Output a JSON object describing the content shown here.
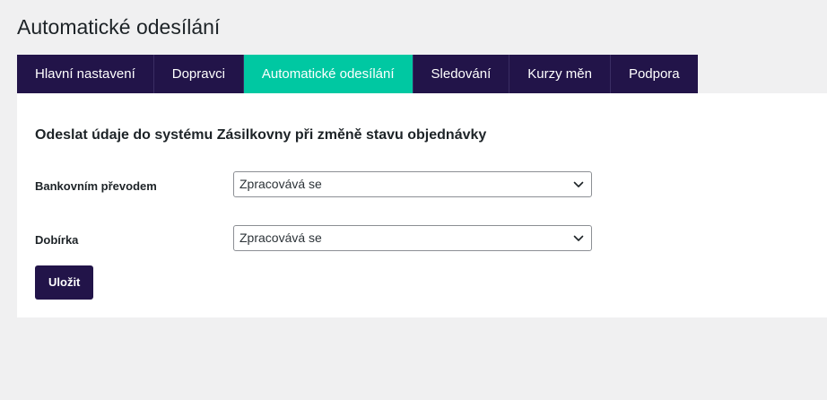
{
  "page": {
    "title": "Automatické odesílání"
  },
  "tabs": [
    {
      "label": "Hlavní nastavení",
      "active": false
    },
    {
      "label": "Dopravci",
      "active": false
    },
    {
      "label": "Automatické odesílání",
      "active": true
    },
    {
      "label": "Sledování",
      "active": false
    },
    {
      "label": "Kurzy měn",
      "active": false
    },
    {
      "label": "Podpora",
      "active": false
    }
  ],
  "form": {
    "heading": "Odeslat údaje do systému Zásilkovny při změně stavu objednávky",
    "fields": [
      {
        "label": "Bankovním převodem",
        "value": "Zpracovává se",
        "icon": "chevron-down-icon"
      },
      {
        "label": "Dobírka",
        "value": "Zpracovává se",
        "icon": "chevron-down-icon"
      }
    ],
    "save_label": "Uložit"
  },
  "colors": {
    "tab_background": "#221449",
    "tab_active": "#00c8a2",
    "button_background": "#221449",
    "page_background": "#f0f0f1",
    "panel_background": "#ffffff"
  }
}
